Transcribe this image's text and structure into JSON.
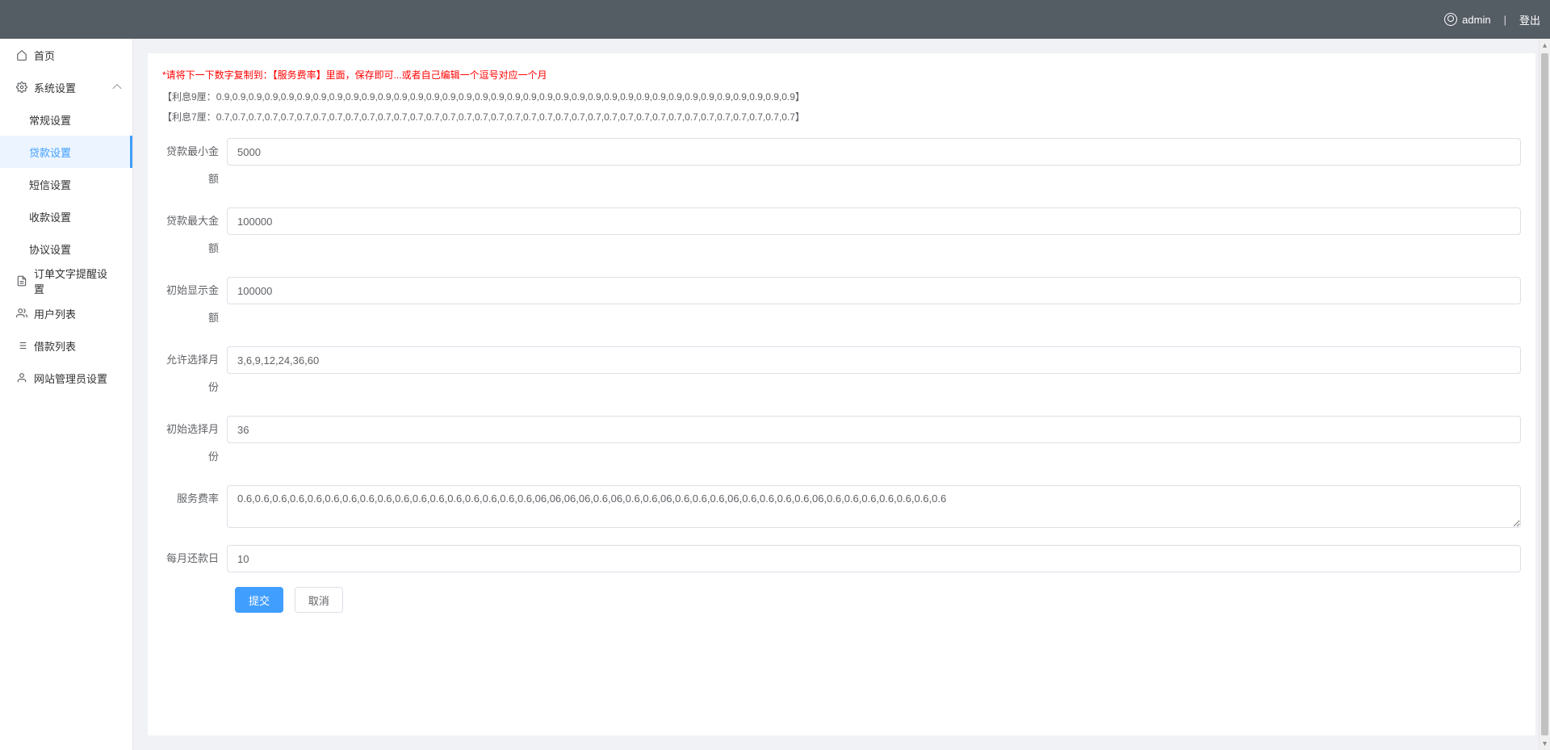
{
  "header": {
    "username": "admin",
    "separator": "|",
    "logout_label": "登出"
  },
  "sidebar": {
    "home": {
      "label": "首页",
      "icon": "home-icon"
    },
    "system_settings": {
      "label": "系统设置",
      "icon": "gear-icon",
      "open": true,
      "items": [
        {
          "key": "general",
          "label": "常规设置"
        },
        {
          "key": "loan",
          "label": "贷款设置",
          "active": true
        },
        {
          "key": "sms",
          "label": "短信设置"
        },
        {
          "key": "payment",
          "label": "收款设置"
        },
        {
          "key": "agreement",
          "label": "协议设置"
        }
      ]
    },
    "order_text_reminder": {
      "label": "订单文字提醒设置",
      "icon": "document-icon"
    },
    "user_list": {
      "label": "用户列表",
      "icon": "users-icon"
    },
    "loan_list": {
      "label": "借款列表",
      "icon": "list-icon"
    },
    "admin_settings": {
      "label": "网站管理员设置",
      "icon": "user-icon"
    }
  },
  "panel": {
    "notice": "*请将下一下数字复制到：【服务费率】里面，保存即可...或者自己编辑一个逗号对应一个月",
    "rate9_label": "【利息9厘：",
    "rate9_value": "0.9,0.9,0.9,0.9,0.9,0.9,0.9,0.9,0.9,0.9,0.9,0.9,0.9,0.9,0.9,0.9,0.9,0.9,0.9,0.9,0.9,0.9,0.9,0.9,0.9,0.9,0.9,0.9,0.9,0.9,0.9,0.9,0.9,0.9,0.9,0.9",
    "rate9_suffix": "】",
    "rate7_label": "【利息7厘：",
    "rate7_value": "0.7,0.7,0.7,0.7,0.7,0.7,0.7,0.7,0.7,0.7,0.7,0.7,0.7,0.7,0.7,0.7,0.7,0.7,0.7,0.7,0.7,0.7,0.7,0.7,0.7,0.7,0.7,0.7,0.7,0.7,0.7,0.7,0.7,0.7,0.7,0.7",
    "rate7_suffix": "】"
  },
  "form": {
    "min_amount": {
      "label": "贷款最小金额",
      "value": "5000"
    },
    "max_amount": {
      "label": "贷款最大金额",
      "value": "100000"
    },
    "initial_amount": {
      "label": "初始显示金额",
      "value": "100000"
    },
    "allowed_months": {
      "label": "允许选择月份",
      "value": "3,6,9,12,24,36,60"
    },
    "initial_months": {
      "label": "初始选择月份",
      "value": "36"
    },
    "service_rate": {
      "label": "服务费率",
      "value": "0.6,0.6,0.6,0.6,0.6,0.6,0.6,0.6,0.6,0.6,0.6,0.6,0.6,0.6,0.6,0.6,0.6,06,06,06,06,0.6,06,0.6,0.6,06,0.6,0.6,0.6,06,0.6,0.6,0.6,0.6,06,0.6,0.6,0.6,0.6,0.6,0.6,0.6"
    },
    "repay_day": {
      "label": "每月还款日",
      "value": "10"
    },
    "submit_label": "提交",
    "cancel_label": "取消"
  }
}
